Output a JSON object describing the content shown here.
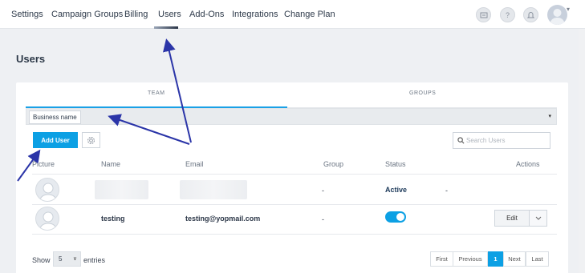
{
  "nav": {
    "items": [
      {
        "label": "Settings"
      },
      {
        "label": "Campaign Groups"
      },
      {
        "label": "Billing"
      },
      {
        "label": "Users"
      },
      {
        "label": "Add-Ons"
      },
      {
        "label": "Integrations"
      },
      {
        "label": "Change Plan"
      }
    ],
    "active_index": 3,
    "icons": [
      "feedback-icon",
      "help-icon",
      "bell-icon"
    ]
  },
  "page": {
    "title": "Users"
  },
  "tabs": [
    {
      "label": "TEAM"
    },
    {
      "label": "GROUPS"
    }
  ],
  "filter": {
    "business_label": "Business name"
  },
  "toolbar": {
    "add_user_label": "Add User",
    "search_placeholder": "Search Users"
  },
  "table": {
    "headers": [
      "Picture",
      "Name",
      "Email",
      "Group",
      "Status",
      "Actions"
    ],
    "rows": [
      {
        "name": "",
        "email": "",
        "group": "-",
        "status": "Active",
        "extra": "-"
      },
      {
        "name": "testing",
        "email": "testing@yopmail.com",
        "group": "-",
        "status_toggle": true,
        "action": "Edit"
      }
    ]
  },
  "footer": {
    "show_label": "Show",
    "entries_value": "5",
    "entries_label": "entries",
    "pagination": [
      "First",
      "Previous",
      "1",
      "Next",
      "Last"
    ],
    "current_page": "1"
  },
  "colors": {
    "accent": "#0ca0e4",
    "annotation_arrow": "#2b35a8"
  }
}
